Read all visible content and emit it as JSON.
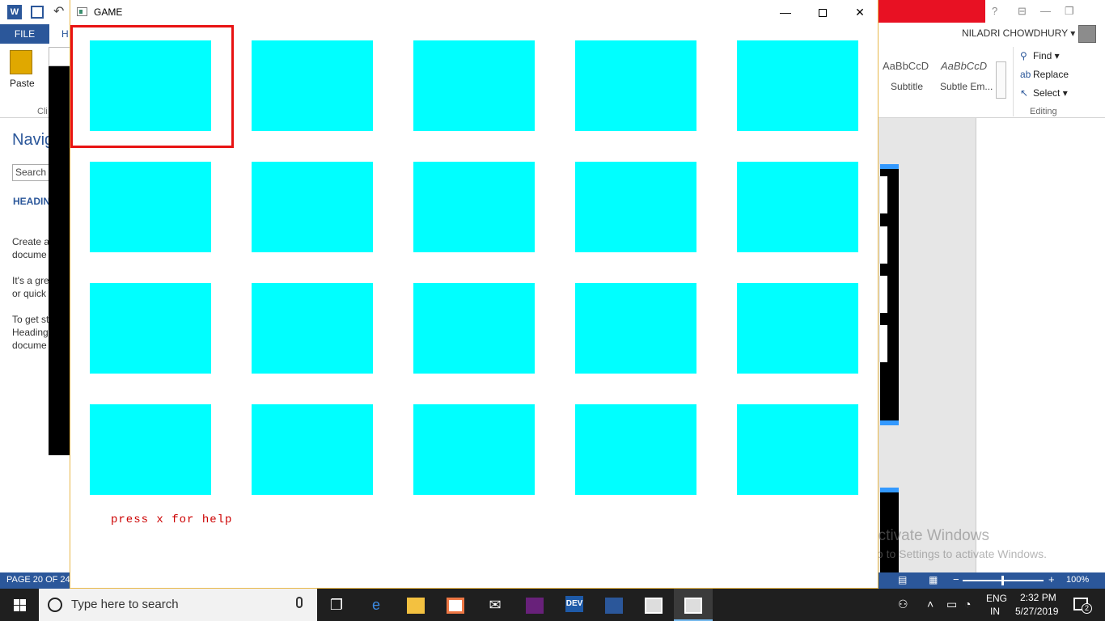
{
  "word": {
    "tabs": {
      "file": "FILE",
      "home": "H"
    },
    "user_name": "NILADRI CHOWDHURY",
    "paste_label": "Paste",
    "clipboard_label": "Cli",
    "styles": [
      {
        "sample": "AaBbCcD",
        "name": "Subtitle"
      },
      {
        "sample": "AaBbCcD",
        "name": "Subtle Em..."
      }
    ],
    "editing": {
      "find": "Find",
      "replace": "Replace",
      "select": "Select",
      "group_label": "Editing"
    },
    "nav_pane": {
      "title": "Navig",
      "search_placeholder": "Search d",
      "headings_tab": "HEADIN",
      "text_lines": [
        "Create a",
        "docume",
        "It's a gre",
        "or quick",
        "To get st",
        "Heading",
        "docume"
      ]
    },
    "status": {
      "page": "PAGE 20 OF 24",
      "zoom": "100%"
    },
    "activation": {
      "title": "Activate Windows",
      "subtitle": "Go to Settings to activate Windows."
    }
  },
  "game": {
    "title": "GAME",
    "window_controls": {
      "minimize": "—",
      "close": "✕"
    },
    "tile_color": "#00ffff",
    "selector_color": "#e81212",
    "grid": {
      "rows": 4,
      "cols": 5
    },
    "selected": {
      "row": 1,
      "col": 1
    },
    "help_text": "press x for help"
  },
  "taskbar": {
    "search_placeholder": "Type here to search",
    "apps": [
      {
        "name": "task-view-icon"
      },
      {
        "name": "edge-icon"
      },
      {
        "name": "file-explorer-icon"
      },
      {
        "name": "store-icon"
      },
      {
        "name": "mail-icon"
      },
      {
        "name": "visual-studio-icon"
      },
      {
        "name": "dev-cpp-icon",
        "label": "DEV"
      },
      {
        "name": "word-icon"
      },
      {
        "name": "console-app-icon"
      },
      {
        "name": "game-app-icon"
      }
    ],
    "language": {
      "top": "ENG",
      "bottom": "IN"
    },
    "clock": {
      "time": "2:32 PM",
      "date": "5/27/2019"
    },
    "notification_count": "2"
  }
}
